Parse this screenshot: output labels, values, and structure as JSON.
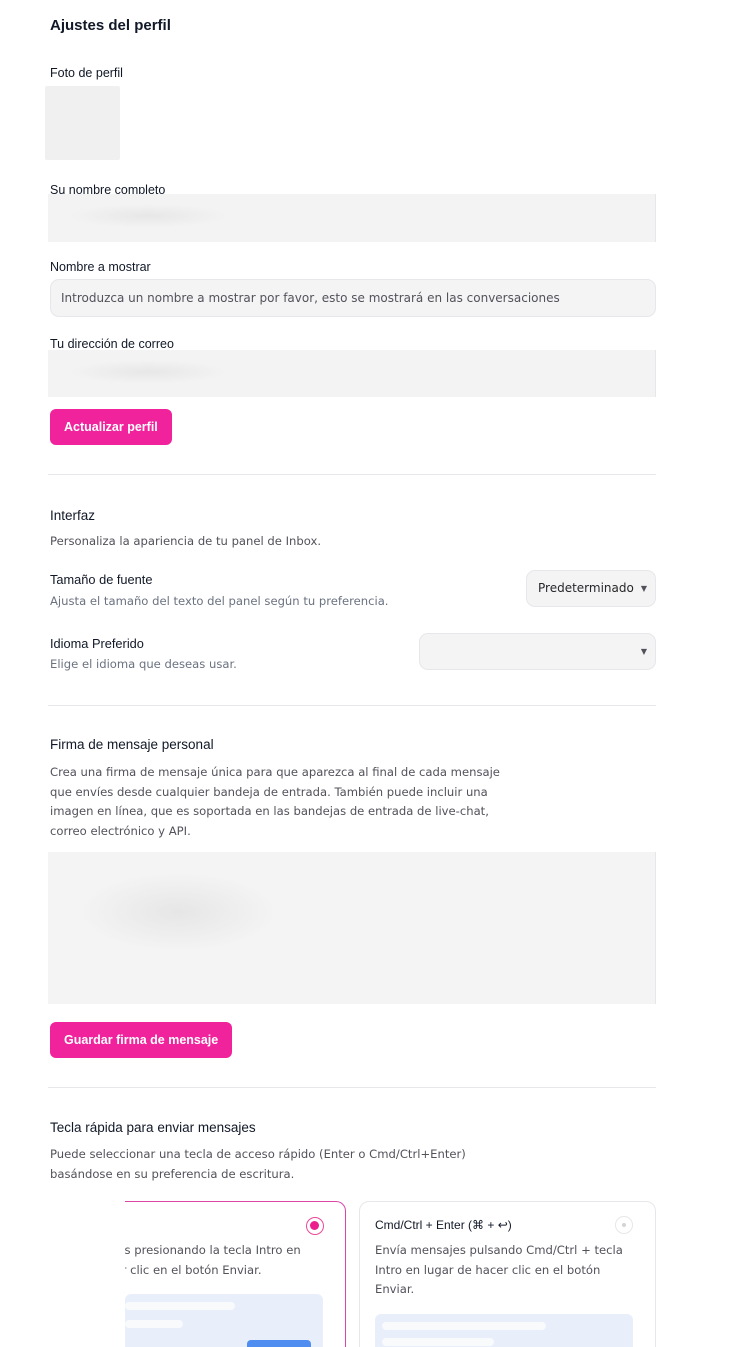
{
  "page": {
    "title": "Ajustes del perfil"
  },
  "profile": {
    "photo_label": "Foto de perfil",
    "full_name_label": "Su nombre completo",
    "display_name_label": "Nombre a mostrar",
    "display_name_placeholder": "Introduzca un nombre a mostrar por favor, esto se mostrará en las conversaciones",
    "email_label": "Tu dirección de correo",
    "update_button": "Actualizar perfil"
  },
  "interface": {
    "title": "Interfaz",
    "description": "Personaliza la apariencia de tu panel de Inbox.",
    "font_size": {
      "title": "Tamaño de fuente",
      "description": "Ajusta el tamaño del texto del panel según tu preferencia.",
      "selected": "Predeterminado"
    },
    "language": {
      "title": "Idioma Preferido",
      "description": "Elige el idioma que deseas usar.",
      "selected": ""
    }
  },
  "signature": {
    "title": "Firma de mensaje personal",
    "description": "Crea una firma de mensaje única para que aparezca al final de cada mensaje que envíes desde cualquier bandeja de entrada. También puede incluir una imagen en línea, que es soportada en las bandejas de entrada de live-chat, correo electrónico y API.",
    "desc_lines": [
      "Crea una firma de mensaje única para que aparezca al final de cada mensaje",
      "que envíes desde cualquier bandeja de entrada. También puede incluir una",
      "imagen en línea, que es soportada en las bandejas de entrada de live-chat,",
      "correo electrónico y API."
    ],
    "save_button": "Guardar firma de mensaje"
  },
  "hotkey": {
    "title": "Tecla rápida para enviar mensajes",
    "desc_lines": [
      "Puede seleccionar una tecla de acceso rápido (Enter o Cmd/Ctrl+Enter)",
      "basándose en su preferencia de escritura."
    ],
    "option_enter": {
      "desc_lines": [
        "sajes presionando la tecla Intro en",
        "acer clic en el botón Enviar."
      ],
      "selected": true
    },
    "option_cmd_enter": {
      "title": "Cmd/Ctrl + Enter (⌘ + ↩)",
      "desc_lines": [
        "Envía mensajes pulsando Cmd/Ctrl + tecla",
        "Intro en lugar de hacer clic en el botón",
        "Enviar."
      ],
      "selected": false
    }
  },
  "colors": {
    "accent": "#f0229c",
    "accent_border": "#d946a8"
  }
}
